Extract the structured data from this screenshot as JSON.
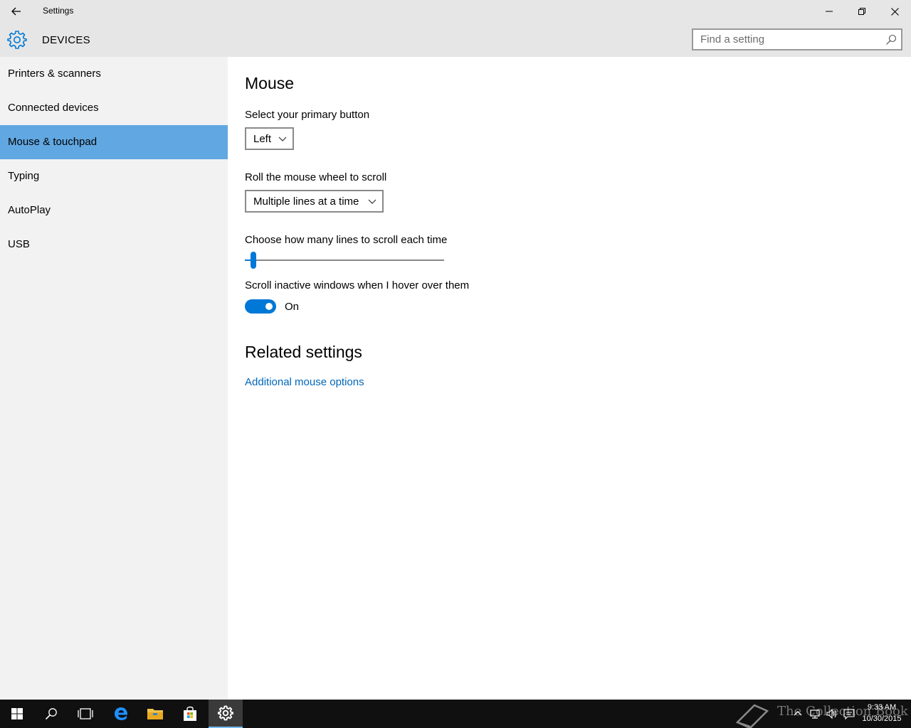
{
  "window": {
    "title": "Settings"
  },
  "header": {
    "title": "DEVICES",
    "search_placeholder": "Find a setting"
  },
  "sidebar": {
    "items": [
      {
        "label": "Printers & scanners"
      },
      {
        "label": "Connected devices"
      },
      {
        "label": "Mouse & touchpad",
        "selected": true
      },
      {
        "label": "Typing"
      },
      {
        "label": "AutoPlay"
      },
      {
        "label": "USB"
      }
    ]
  },
  "main": {
    "title": "Mouse",
    "primary_button": {
      "label": "Select your primary button",
      "value": "Left"
    },
    "wheel_scroll": {
      "label": "Roll the mouse wheel to scroll",
      "value": "Multiple lines at a time"
    },
    "scroll_lines": {
      "label": "Choose how many lines to scroll each time",
      "slider_fraction": 0.03
    },
    "inactive_scroll": {
      "label": "Scroll inactive windows when I hover over them",
      "state_text": "On",
      "on": true
    },
    "related": {
      "title": "Related settings",
      "link": "Additional mouse options"
    }
  },
  "taskbar": {
    "clock_time": "9:33 AM",
    "clock_date": "10/30/2015",
    "watermark": "The Collection Book"
  },
  "colors": {
    "accent": "#0078d7",
    "selected_item": "#61a7e2",
    "link": "#0067b8"
  }
}
